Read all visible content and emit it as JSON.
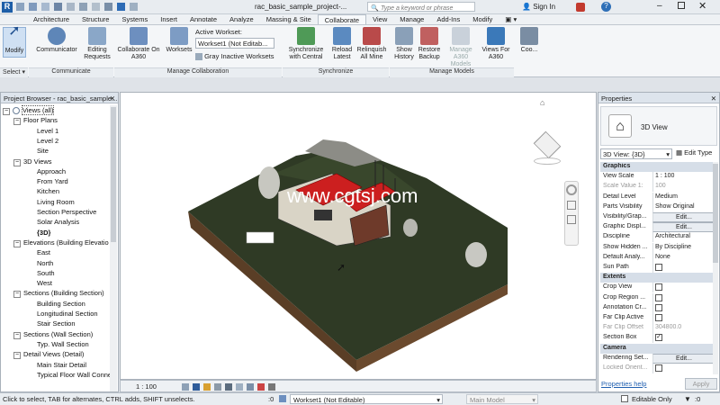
{
  "title": {
    "file": "rac_basic_sample_project-...",
    "search_placeholder": "Type a keyword or phrase",
    "sign_in": "Sign In"
  },
  "tabs": [
    "Architecture",
    "Structure",
    "Systems",
    "Insert",
    "Annotate",
    "Analyze",
    "Massing & Site",
    "Collaborate",
    "View",
    "Manage",
    "Add-Ins",
    "Modify"
  ],
  "active_tab": "Collaborate",
  "ribbon": {
    "modify": "Modify",
    "communicator": "Communicator",
    "editing_requests": "Editing Requests",
    "collaborate_a360": "Collaborate On A360",
    "worksets": "Worksets",
    "active_workset_label": "Active Workset:",
    "active_workset_value": "Workset1 (Not Editab...",
    "gray_inactive": "Gray Inactive Worksets",
    "sync_central": "Synchronize with Central",
    "reload_latest": "Reload Latest",
    "relinquish_all": "Relinquish All Mine",
    "show_history": "Show History",
    "restore_backup": "Restore Backup",
    "manage_a360": "Manage A360 Models",
    "views_a360": "Views For A360",
    "coo": "Coo...",
    "groups": {
      "select": "Select",
      "communicate": "Communicate",
      "manage_collab": "Manage Collaboration",
      "synchronize": "Synchronize",
      "manage_models": "Manage Models"
    }
  },
  "project_browser": {
    "title": "Project Browser - rac_basic_sample...",
    "items": [
      {
        "label": "Views (all)",
        "level": 0,
        "toggle": "−"
      },
      {
        "label": "Floor Plans",
        "level": 1,
        "toggle": "−"
      },
      {
        "label": "Level 1",
        "level": 2
      },
      {
        "label": "Level 2",
        "level": 2
      },
      {
        "label": "Site",
        "level": 2
      },
      {
        "label": "3D Views",
        "level": 1,
        "toggle": "−"
      },
      {
        "label": "Approach",
        "level": 2
      },
      {
        "label": "From Yard",
        "level": 2
      },
      {
        "label": "Kitchen",
        "level": 2
      },
      {
        "label": "Living Room",
        "level": 2
      },
      {
        "label": "Section Perspective",
        "level": 2
      },
      {
        "label": "Solar Analysis",
        "level": 2
      },
      {
        "label": "{3D}",
        "level": 2,
        "bold": true
      },
      {
        "label": "Elevations (Building Elevatio",
        "level": 1,
        "toggle": "−"
      },
      {
        "label": "East",
        "level": 2
      },
      {
        "label": "North",
        "level": 2
      },
      {
        "label": "South",
        "level": 2
      },
      {
        "label": "West",
        "level": 2
      },
      {
        "label": "Sections (Building Section)",
        "level": 1,
        "toggle": "−"
      },
      {
        "label": "Building Section",
        "level": 2
      },
      {
        "label": "Longitudinal Section",
        "level": 2
      },
      {
        "label": "Stair Section",
        "level": 2
      },
      {
        "label": "Sections (Wall Section)",
        "level": 1,
        "toggle": "−"
      },
      {
        "label": "Typ. Wall Section",
        "level": 2
      },
      {
        "label": "Detail Views (Detail)",
        "level": 1,
        "toggle": "−"
      },
      {
        "label": "Main Stair Detail",
        "level": 2
      },
      {
        "label": "Typical Floor Wall Conne",
        "level": 2
      }
    ]
  },
  "viewport": {
    "watermark": "www.cgtsj.com",
    "scale": "1 : 100",
    "nav_colors": {
      "ground": "#2f3a25",
      "soil": "#6b4a2e",
      "roof": "#cc1f1f"
    }
  },
  "properties": {
    "title": "Properties",
    "type_name": "3D View",
    "selector": "3D View: {3D}",
    "edit_type": "Edit Type",
    "rows": [
      {
        "section": "Graphics"
      },
      {
        "k": "View Scale",
        "v": "1 : 100"
      },
      {
        "k": "Scale Value  1:",
        "v": "100",
        "gray": true
      },
      {
        "k": "Detail Level",
        "v": "Medium"
      },
      {
        "k": "Parts Visibility",
        "v": "Show Original"
      },
      {
        "k": "Visibility/Grap...",
        "v": "Edit...",
        "btn": true
      },
      {
        "k": "Graphic Displ...",
        "v": "Edit...",
        "btn": true
      },
      {
        "k": "Discipline",
        "v": "Architectural"
      },
      {
        "k": "Show Hidden ...",
        "v": "By Discipline"
      },
      {
        "k": "Default Analy...",
        "v": "None"
      },
      {
        "k": "Sun Path",
        "check": false
      },
      {
        "section": "Extents"
      },
      {
        "k": "Crop View",
        "check": false
      },
      {
        "k": "Crop Region ...",
        "check": false
      },
      {
        "k": "Annotation Cr...",
        "check": false
      },
      {
        "k": "Far Clip Active",
        "check": false
      },
      {
        "k": "Far Clip Offset",
        "v": "304800.0",
        "gray": true
      },
      {
        "k": "Section Box",
        "check": true
      },
      {
        "section": "Camera"
      },
      {
        "k": "Rendering Set...",
        "v": "Edit...",
        "btn": true
      },
      {
        "k": "Locked Orient...",
        "check": false,
        "gray": true
      }
    ],
    "help": "Properties help",
    "apply": "Apply"
  },
  "status": {
    "hint": "Click to select, TAB for alternates, CTRL adds, SHIFT unselects.",
    "workset": "Workset1 (Not Editable)",
    "model": "Main Model",
    "editable_only": "Editable Only",
    "zero": ":0"
  }
}
